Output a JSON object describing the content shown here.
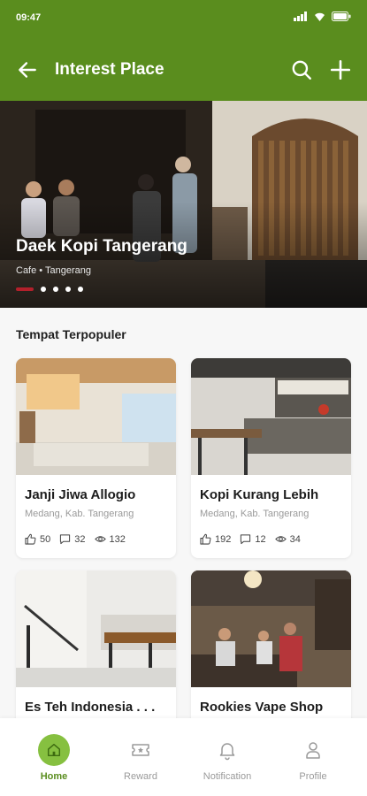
{
  "status_bar": {
    "time": "09:47"
  },
  "app_bar": {
    "title": "Interest Place"
  },
  "hero": {
    "name": "Daek Kopi Tangerang",
    "meta": "Cafe • Tangerang",
    "slide_count": 5,
    "active_index": 0
  },
  "section": {
    "title": "Tempat Terpopuler"
  },
  "places": [
    {
      "name": "Janji Jiwa Allogio",
      "location": "Medang, Kab. Tangerang",
      "likes": "50",
      "comments": "32",
      "views": "132"
    },
    {
      "name": "Kopi Kurang Lebih",
      "location": "Medang, Kab. Tangerang",
      "likes": "192",
      "comments": "12",
      "views": "34"
    },
    {
      "name": "Es Teh Indonesia . . .",
      "location": "",
      "likes": "",
      "comments": "",
      "views": ""
    },
    {
      "name": "Rookies Vape Shop",
      "location": "",
      "likes": "",
      "comments": "",
      "views": ""
    }
  ],
  "bottom_nav": [
    {
      "label": "Home",
      "icon": "home-icon",
      "active": true
    },
    {
      "label": "Reward",
      "icon": "ticket-icon",
      "active": false
    },
    {
      "label": "Notification",
      "icon": "bell-icon",
      "active": false
    },
    {
      "label": "Profile",
      "icon": "user-icon",
      "active": false
    }
  ],
  "colors": {
    "primary": "#5a8d1e",
    "active_tab": "#86c040",
    "slider_active": "#b3202b"
  }
}
